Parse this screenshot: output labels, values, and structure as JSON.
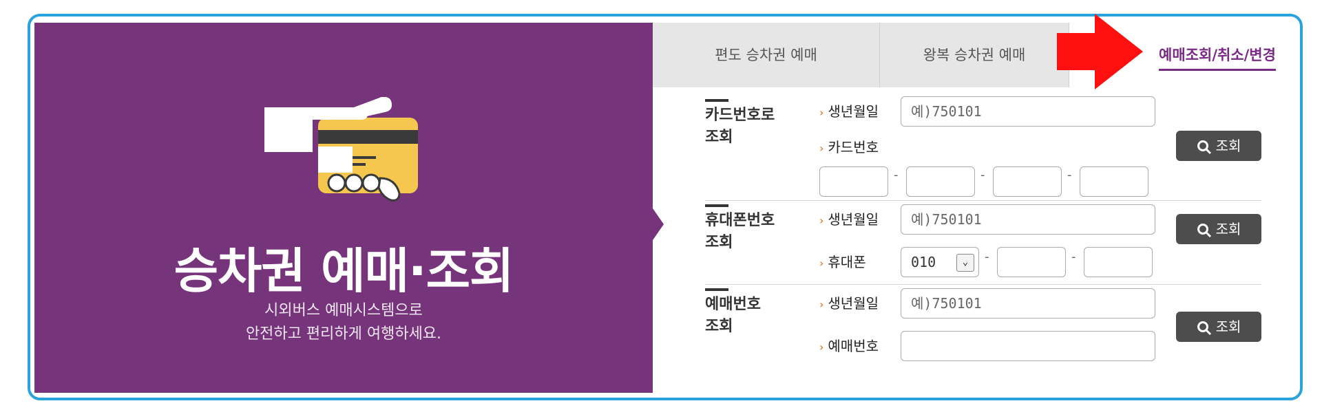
{
  "banner": {
    "title": "승차권 예매·조회",
    "subtitle_line1": "시외버스 예매시스템으로",
    "subtitle_line2": "안전하고 편리하게 여행하세요."
  },
  "tabs": {
    "oneway": "편도 승차권 예매",
    "round": "왕복 승차권 예매",
    "inquiry": "예매조회/취소/변경"
  },
  "card_section": {
    "title_line1": "카드번호로",
    "title_line2": "조회",
    "birth_label": "생년월일",
    "birth_placeholder": "예)750101",
    "card_label": "카드번호",
    "button": "조회"
  },
  "phone_section": {
    "title_line1": "휴대폰번호",
    "title_line2": "조회",
    "birth_label": "생년월일",
    "birth_placeholder": "예)750101",
    "phone_label": "휴대폰",
    "phone_prefix": "010",
    "button": "조회"
  },
  "reservation_section": {
    "title_line1": "예매번호",
    "title_line2": "조회",
    "birth_label": "생년월일",
    "birth_placeholder": "예)750101",
    "number_label": "예매번호",
    "button": "조회"
  },
  "dash": "-",
  "colors": {
    "banner": "#76357b",
    "frame": "#29a3dc",
    "accent": "#7a2a86",
    "button": "#4d4d4d"
  }
}
